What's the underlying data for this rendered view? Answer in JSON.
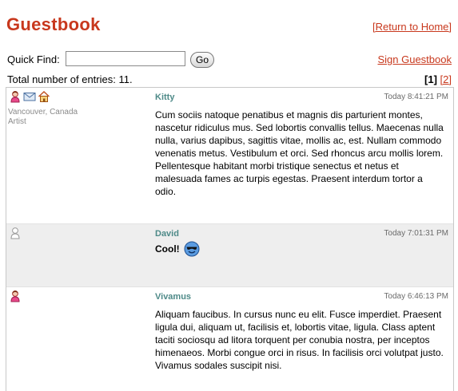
{
  "header": {
    "title": "Guestbook",
    "home_link": "[Return to Home]"
  },
  "search": {
    "label": "Quick Find:",
    "value": "",
    "placeholder": "",
    "go_label": "Go"
  },
  "sign_link": "Sign Guestbook",
  "total": "Total number of entries: 11.",
  "pager": {
    "open": "[",
    "current": "1",
    "close": "]",
    "next": "[2]"
  },
  "entries": [
    {
      "name": "Kitty",
      "time": "Today 8:41:21 PM",
      "location": "Vancouver, Canada",
      "occupation": "Artist",
      "icons": [
        "female-user-icon",
        "email-icon",
        "homepage-icon"
      ],
      "message": "Cum sociis natoque penatibus et magnis dis parturient montes, nascetur ridiculus mus. Sed lobortis convallis tellus. Maecenas nulla nulla, varius dapibus, sagittis vitae, mollis ac, est. Nullam commodo venenatis metus. Vestibulum et orci. Sed rhoncus arcu mollis lorem. Pellentesque habitant morbi tristique senectus et netus et malesuada fames ac turpis egestas. Praesent interdum tortor a odio."
    },
    {
      "name": "David",
      "time": "Today 7:01:31 PM",
      "icons": [
        "male-user-icon"
      ],
      "message": "Cool!",
      "emoticon": "cool-smiley-icon"
    },
    {
      "name": "Vivamus",
      "time": "Today 6:46:13 PM",
      "icons": [
        "female-user-icon"
      ],
      "message": "Aliquam faucibus. In cursus nunc eu elit. Fusce imperdiet. Praesent ligula dui, aliquam ut, facilisis et, lobortis vitae, ligula. Class aptent taciti sociosqu ad litora torquent per conubia nostra, per inceptos himenaeos. Morbi congue orci in risus. In facilisis orci volutpat justo. Vivamus sodales suscipit nisi."
    }
  ],
  "colors": {
    "accent": "#c8381d",
    "name": "#4e8a88",
    "meta": "#8a8a8a",
    "alt_row": "#eeeeee"
  }
}
